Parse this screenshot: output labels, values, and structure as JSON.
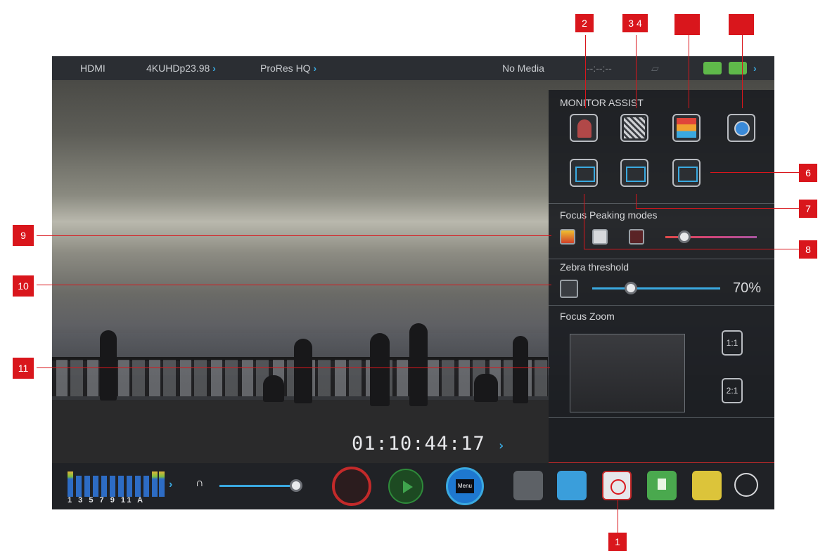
{
  "status_bar": {
    "input": "HDMI",
    "resolution": "4KUHDp23.98",
    "codec": "ProRes HQ",
    "media": "No Media",
    "remaining": "--:--:--"
  },
  "timecode": "01:10:44:17",
  "monitor_assist": {
    "title": "MONITOR ASSIST",
    "focus_peaking_title": "Focus Peaking modes",
    "zebra_title": "Zebra threshold",
    "zebra_value": "70%",
    "zebra_level": 0.7,
    "focus_zoom_title": "Focus Zoom",
    "zoom_options": [
      "1:1",
      "2:1"
    ]
  },
  "bottom_bar": {
    "meter_labels": "1 3 5 7 9 11 A",
    "menu_label": "Menu"
  },
  "callouts": [
    "2",
    "3 4",
    "6",
    "7",
    "8",
    "9",
    "10",
    "11",
    "1"
  ],
  "colors": {
    "accent": "#3aa9e0",
    "callout": "#d9161c",
    "record": "#c32a2a",
    "play": "#2e8a3a",
    "menu": "#1e78d0"
  }
}
